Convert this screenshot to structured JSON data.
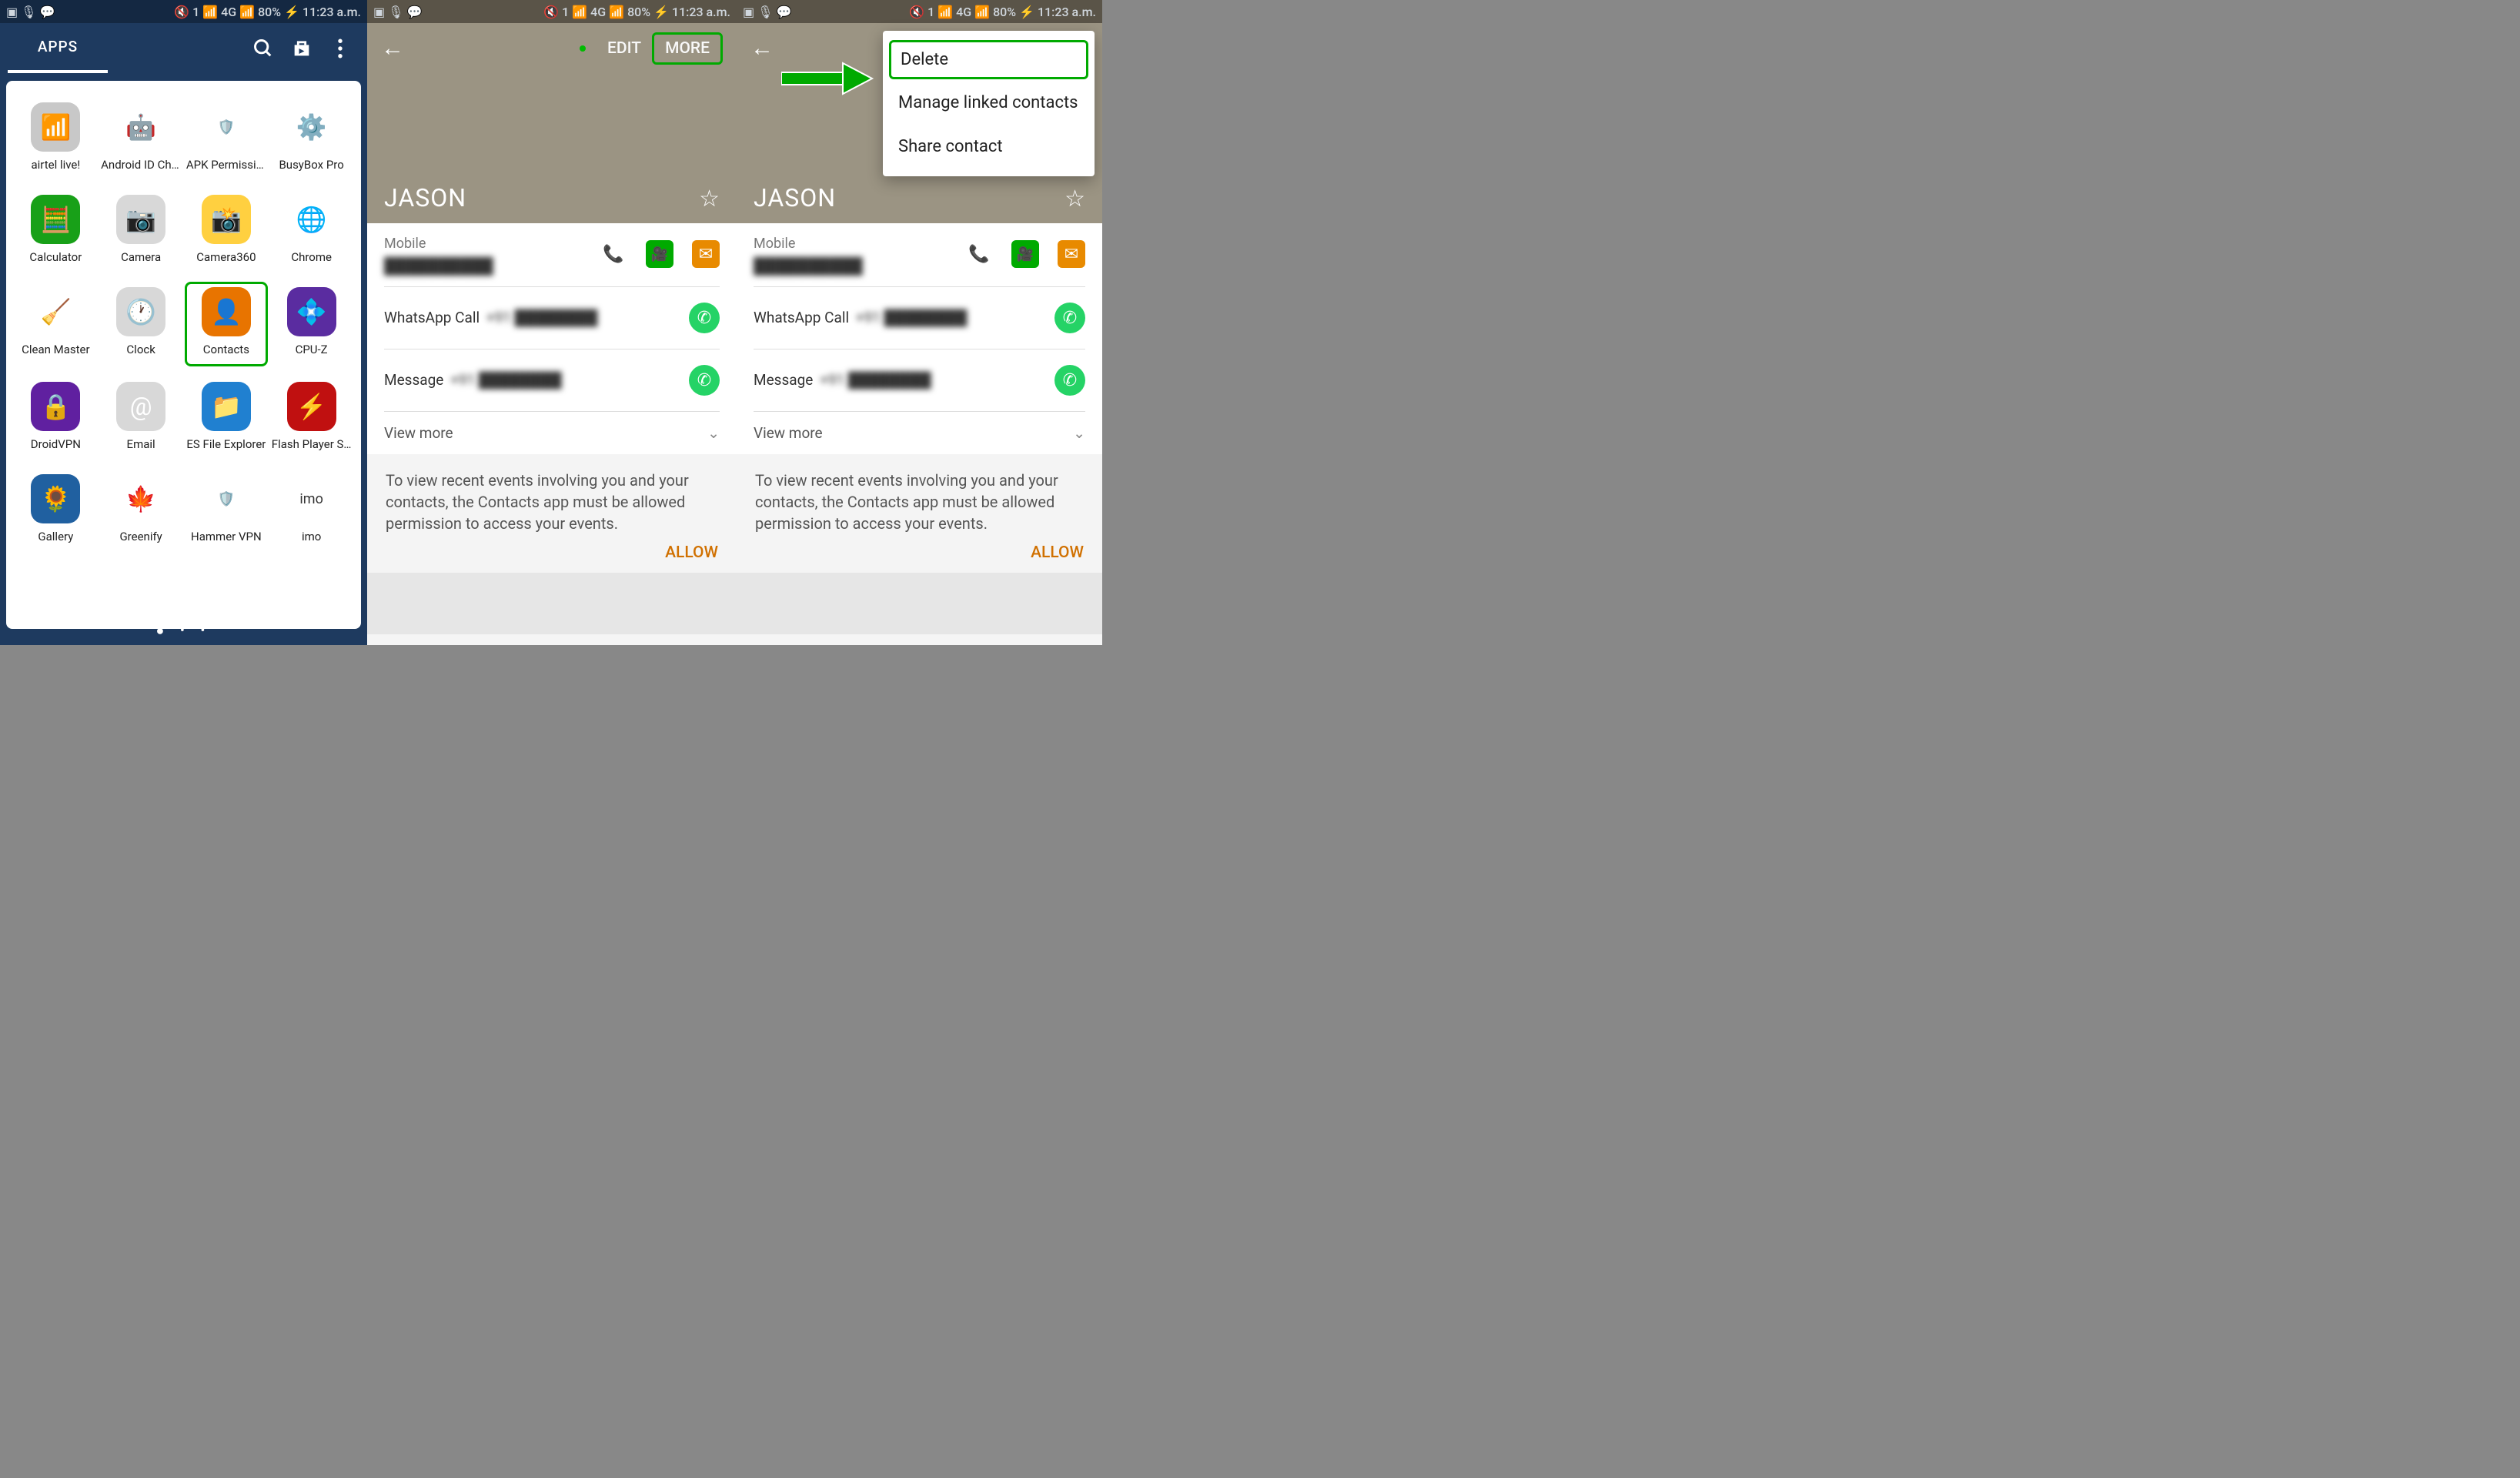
{
  "status": {
    "battery": "80%",
    "time": "11:23 a.m.",
    "signal_type": "4G"
  },
  "screen1": {
    "tab_label": "APPS",
    "apps": [
      {
        "label": "airtel live!",
        "bg": "#c8c8c8",
        "emoji": "📶"
      },
      {
        "label": "Android ID Cha…",
        "bg": "#fff",
        "emoji": "🤖"
      },
      {
        "label": "APK Permissio…",
        "bg": "#fff",
        "emoji": "🛡️"
      },
      {
        "label": "BusyBox Pro",
        "bg": "#fff",
        "emoji": "⚙️"
      },
      {
        "label": "Calculator",
        "bg": "#18a018",
        "emoji": "🧮"
      },
      {
        "label": "Camera",
        "bg": "#d8d8d8",
        "emoji": "📷"
      },
      {
        "label": "Camera360",
        "bg": "#ffd040",
        "emoji": "📸"
      },
      {
        "label": "Chrome",
        "bg": "#fff",
        "emoji": "🌐"
      },
      {
        "label": "Clean Master",
        "bg": "#fff",
        "emoji": "🧹"
      },
      {
        "label": "Clock",
        "bg": "#d8d8d8",
        "emoji": "🕐"
      },
      {
        "label": "Contacts",
        "bg": "#e87400",
        "emoji": "👤"
      },
      {
        "label": "CPU-Z",
        "bg": "#5a2ca0",
        "emoji": "💠"
      },
      {
        "label": "DroidVPN",
        "bg": "#6020a0",
        "emoji": "🔒"
      },
      {
        "label": "Email",
        "bg": "#d8d8d8",
        "emoji": "@"
      },
      {
        "label": "ES File Explorer",
        "bg": "#2080d0",
        "emoji": "📁"
      },
      {
        "label": "Flash Player S…",
        "bg": "#c01010",
        "emoji": "⚡"
      },
      {
        "label": "Gallery",
        "bg": "#2060a0",
        "emoji": "🌻"
      },
      {
        "label": "Greenify",
        "bg": "#fff",
        "emoji": "🍁"
      },
      {
        "label": "Hammer VPN",
        "bg": "#fff",
        "emoji": "🛡️"
      },
      {
        "label": "imo",
        "bg": "#fff",
        "emoji": "imo"
      }
    ]
  },
  "contact": {
    "edit": "EDIT",
    "more": "MORE",
    "name": "JASON",
    "mobile_label": "Mobile",
    "mobile_value": "██████████",
    "wa_call_label": "WhatsApp Call",
    "wa_call_num": "+91 ████████",
    "wa_msg_label": "Message",
    "wa_msg_num": "+91 ████████",
    "view_more": "View more",
    "perm": "To view recent events involving you and your contacts, the Contacts app must be allowed permission to access your events.",
    "allow": "ALLOW"
  },
  "popup": {
    "delete": "Delete",
    "manage": "Manage linked contacts",
    "share": "Share contact"
  }
}
